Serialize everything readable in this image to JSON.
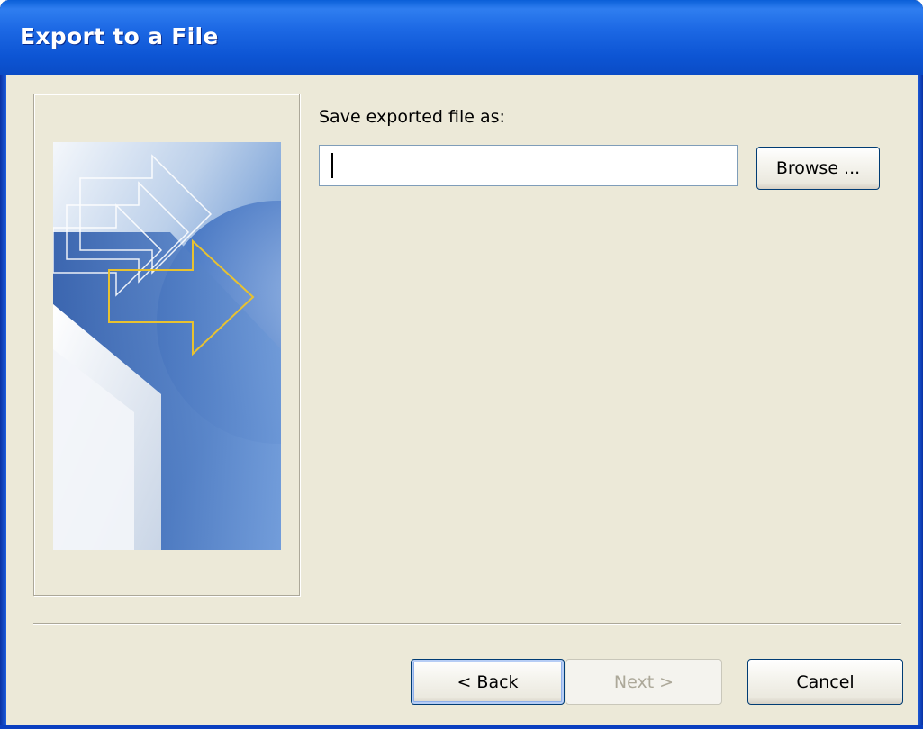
{
  "window": {
    "title": "Export to a File"
  },
  "main": {
    "save_label": "Save exported file as:",
    "filename": {
      "value": "",
      "placeholder": ""
    },
    "browse_label": "Browse ..."
  },
  "footer": {
    "back_label": "< Back",
    "next_label": "Next >",
    "cancel_label": "Cancel"
  },
  "colors": {
    "titlebar": "#0a55d4",
    "dialog_bg": "#ece9d8",
    "input_border": "#7f9db9",
    "button_border": "#003c74",
    "disabled_text": "#aca899"
  },
  "icons": {
    "wizard_art": "export-arrows-graphic"
  }
}
